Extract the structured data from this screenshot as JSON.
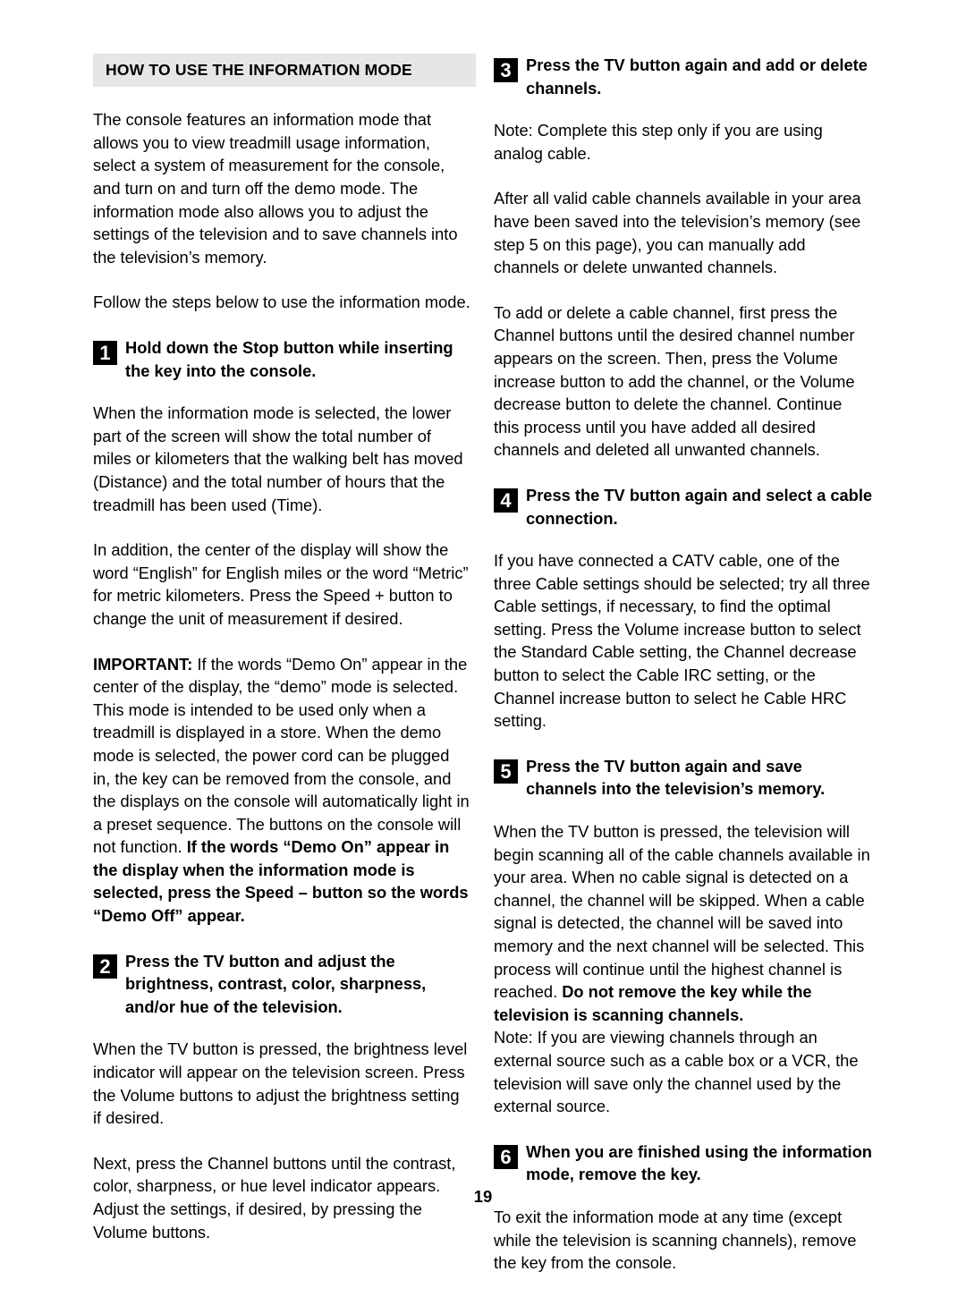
{
  "page": {
    "number": "19"
  },
  "left_column": {
    "section_header": "HOW TO USE THE INFORMATION MODE",
    "intro_paragraph_1": "The console features an information mode that allows you to view treadmill usage information, select a system of measurement for the console, and turn on and turn off the demo mode. The information mode also allows you to adjust the settings of the television and to save channels into the television’s memory.",
    "intro_paragraph_2": "Follow the steps below to use the information mode.",
    "step1": {
      "number": "1",
      "title": "Hold down the Stop button while inserting the key into the console.",
      "paragraph_1": "When the information mode is selected, the lower part of the screen will show the total number of miles or kilometers that the walking belt has moved (Distance) and the total number of hours that the treadmill has been used (Time).",
      "paragraph_2": "In addition, the center of the display will show the word “English” for English miles or the word “Metric” for metric kilometers. Press the Speed + button to change the unit of measurement if desired.",
      "important_label": "IMPORTANT:",
      "important_body": " If the words “Demo On” appear in the center of the display, the “demo” mode is selected. This mode is intended to be used only when a treadmill is displayed in a store. When the demo mode is selected, the power cord can be plugged in, the key can be removed from the console, and the displays on the console will automatically light in a preset sequence. The buttons on the console will not function. ",
      "important_bold_tail": "If the words “Demo On” appear in the display when the information mode is selected, press the Speed – button so the words “Demo Off” appear."
    },
    "step2": {
      "number": "2",
      "title": "Press the TV button and adjust the brightness, contrast, color, sharpness, and/or hue of the television.",
      "paragraph_1": "When the TV button is pressed, the brightness level indicator will appear on the television screen. Press the Volume buttons to adjust the brightness setting if desired.",
      "paragraph_2": "Next, press the Channel buttons until the contrast, color, sharpness, or hue level indicator appears. Adjust the settings, if desired, by pressing the Volume buttons."
    }
  },
  "right_column": {
    "step3": {
      "number": "3",
      "title": "Press the TV button again and add or delete channels.",
      "paragraph_1": "Note: Complete this step only if you are using analog cable.",
      "paragraph_2": "After all valid cable channels available in your area have been saved into the television’s memory (see step 5 on this page), you can manually add channels or delete unwanted channels.",
      "paragraph_3": "To add or delete a cable channel, first press the Channel buttons until the desired channel number appears on the screen. Then, press the Volume increase button to add the channel, or the Volume decrease button to delete the channel. Continue this process until you have added all desired channels and deleted all unwanted channels."
    },
    "step4": {
      "number": "4",
      "title": "Press the TV button again and select a cable connection.",
      "paragraph_1": "If you have connected a CATV cable, one of the three Cable settings should be selected; try all three Cable settings, if necessary, to find the optimal setting. Press the Volume increase button to select the Standard Cable setting, the Channel decrease button to select the Cable IRC setting, or the Channel increase button to select he Cable HRC setting."
    },
    "step5": {
      "number": "5",
      "title": "Press the TV button again and save channels into the television’s memory.",
      "paragraph_1_head": "When the TV button is pressed, the television will begin scanning all of the cable channels available in your area. When no cable signal is detected on a channel, the channel will be skipped. When a cable signal is detected, the channel will be saved into memory and the next channel will be selected. This process will continue until the highest channel is reached. ",
      "paragraph_1_bold": "Do not remove the key while the television is scanning channels.",
      "paragraph_2": "Note: If you are viewing channels through an external source such as a cable box or a VCR, the television will save only the channel used by the external source."
    },
    "step6": {
      "number": "6",
      "title": "When you are finished using the information mode, remove the key.",
      "paragraph_1": "To exit the information mode at any time (except while the television is scanning channels), remove the key from the console."
    }
  }
}
